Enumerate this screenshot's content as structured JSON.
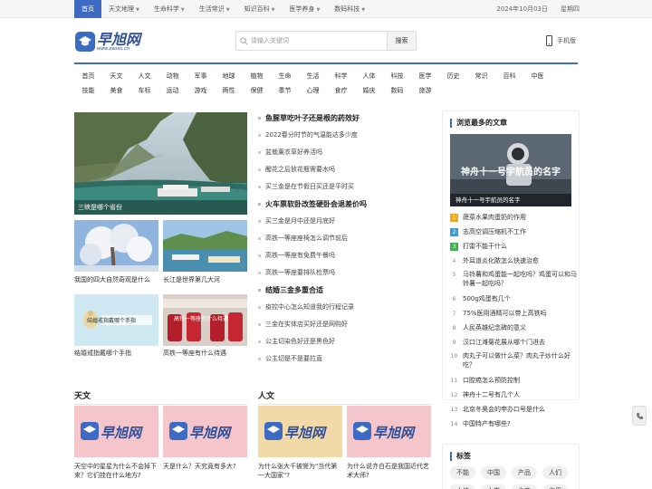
{
  "topnav": {
    "items": [
      "首页",
      "天文地理",
      "生命科学",
      "生活常识",
      "知识百科",
      "医学养身",
      "数码科技"
    ],
    "date": "2024年10月03日",
    "weekday": "星期四"
  },
  "header": {
    "logo_big": "早旭网",
    "logo_small": "www.zaoxu.cn",
    "search_placeholder": "请输入关键词",
    "search_button": "搜索",
    "mobile_label": "手机版"
  },
  "categories": {
    "row1": [
      "首页",
      "天文",
      "人文",
      "动物",
      "军事",
      "地球",
      "植物",
      "生命",
      "生活",
      "科学",
      "人体",
      "科技",
      "医学",
      "历史",
      "常识",
      "百科",
      "中医"
    ],
    "row2": [
      "技能",
      "美食",
      "车标",
      "运动",
      "游戏",
      "两性",
      "保健",
      "季节",
      "心理",
      "食疗",
      "婚庆",
      "数码",
      "旅游"
    ]
  },
  "feature": {
    "caption": "三峡是哪个省份",
    "thumbs": [
      "我国的四大自然奇观是什么",
      "长江是世界第几大河",
      "结婚戒指戴哪个手指",
      "高铁一等座有什么待遇"
    ],
    "thumb_overlay_3": "结婚戒指戴哪个手指",
    "thumb_overlay_4": "高铁一等座有什么待遇"
  },
  "mid": {
    "groups": [
      {
        "head": "鱼腥草吃叶子还是根的药效好",
        "rows": [
          "2022春分时节的气温能达多少度",
          "盆栽薰衣草好养活吗",
          "醒花之后放花瓶需要水吗",
          "买三金是在节假日买还是平时买"
        ]
      },
      {
        "head": "火车票软卧改签硬卧会退差价吗",
        "rows": [
          "买三金是月中还是月底好",
          "高铁一等座座椅怎么调节前后",
          "高铁一等座有免费午餐吗",
          "高铁一等座要排队检票吗"
        ]
      },
      {
        "head": "结婚三金多重合适",
        "rows": [
          "疫控中心怎么知道我的行程记录",
          "三金在实体店买好还是网购好",
          "公主切染色好还是黑色好",
          "公主切是不是要拉直"
        ]
      }
    ]
  },
  "sidebar": {
    "title": "浏览最多的文章",
    "image_title": "神舟十一号宇航员的名字",
    "image_caption": "神舟十一号宇航员的名字",
    "ranks": [
      {
        "num": "1",
        "text": "蔬菜水果肉蛋奶的作用"
      },
      {
        "num": "2",
        "text": "志高空调压缩机不工作"
      },
      {
        "num": "3",
        "text": "打雷不能干什么"
      },
      {
        "num": "4",
        "text": "外耳道炎化脓怎么快速治愈"
      },
      {
        "num": "5",
        "text": "马铃薯和鸡蛋能一起吃吗？鸡蛋可以和马铃薯一起吃吗？"
      },
      {
        "num": "6",
        "text": "500g鸡蛋有几个"
      },
      {
        "num": "7",
        "text": "75%医用酒精可以带上高铁吗"
      },
      {
        "num": "8",
        "text": "人民英雄纪念碑的意义"
      },
      {
        "num": "9",
        "text": "汉口江滩菊花展从哪个门进去"
      },
      {
        "num": "10",
        "text": "肉丸子可以做什么菜？肉丸子炒什么好吃？"
      },
      {
        "num": "11",
        "text": "口腔癌怎么预防控制"
      },
      {
        "num": "12",
        "text": "神舟十二号有几个人"
      },
      {
        "num": "13",
        "text": "北京冬奥会的申办口号是什么"
      },
      {
        "num": "14",
        "text": "中国特产有哪些?"
      }
    ]
  },
  "tags": {
    "title": "标签",
    "items": [
      "不能",
      "中国",
      "产品",
      "人们",
      "人体",
      "人类",
      "会变",
      "作用"
    ]
  },
  "sections": {
    "left_title": "天文",
    "right_title": "人文",
    "left_cards": [
      "天空中的星星为什么不会掉下来？它们挂在什么地方?",
      "天是什么？天究竟有多大?"
    ],
    "right_cards": [
      "为什么张大千被誉为\"当代第一大国家\"?",
      "为什么说齐白石是我国近代艺术大师?"
    ]
  }
}
